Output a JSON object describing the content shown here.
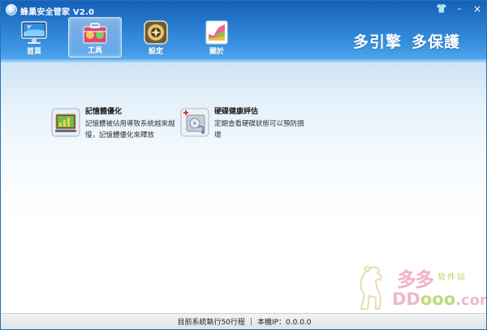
{
  "window": {
    "title": "蜂巢安全管家 V2.0",
    "controls": {
      "skin_glyph": "👕",
      "minimize_glyph": "–",
      "close_glyph": "×"
    }
  },
  "nav": {
    "items": [
      {
        "label": "首頁",
        "icon": "monitor-icon",
        "active": false
      },
      {
        "label": "工具",
        "icon": "toolbox-icon",
        "active": true
      },
      {
        "label": "設定",
        "icon": "settings-icon",
        "active": false
      },
      {
        "label": "關於",
        "icon": "chart-icon",
        "active": false
      }
    ]
  },
  "slogan": {
    "part1": "多引擎",
    "part2": "多保護"
  },
  "tools": [
    {
      "title": "記憶體優化",
      "desc": "記憶體被佔用導致系統越來越慢，記憶體優化來釋放",
      "icon": "memory-optimize-icon"
    },
    {
      "title": "硬碟健康評估",
      "desc": "定期查看硬碟狀態可以預防損壞",
      "icon": "disk-health-icon"
    }
  ],
  "watermark": {
    "cn_big": "多多",
    "cn_small": "软件站",
    "en_a": "DD",
    "en_b": "ooo",
    "en_c": ".com"
  },
  "status": {
    "processes": "目前系統執行50行程",
    "separator": "|",
    "ip": "本機IP：0.0.0.0"
  },
  "colors": {
    "header_top": "#1560b8",
    "header_bottom": "#57a9ec",
    "content_top": "#cde4f6"
  }
}
